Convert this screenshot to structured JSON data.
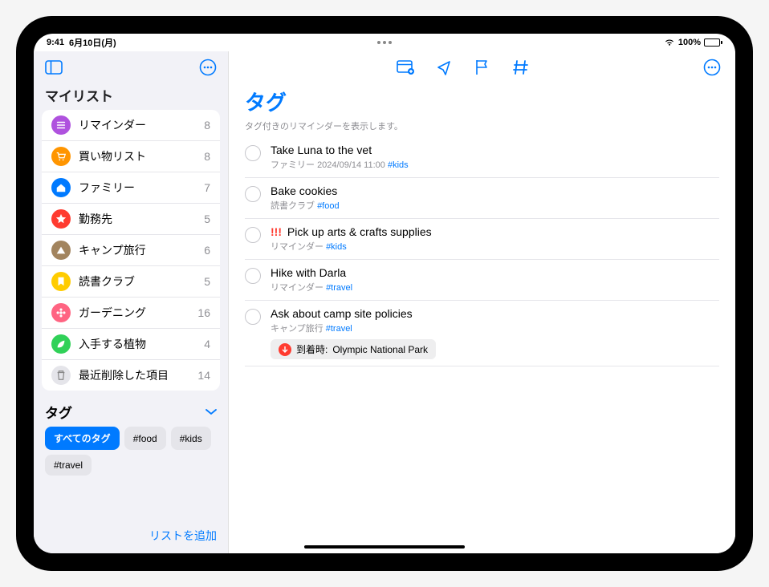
{
  "status": {
    "time": "9:41",
    "date": "6月10日(月)",
    "battery": "100%"
  },
  "sidebar": {
    "section_title": "マイリスト",
    "lists": [
      {
        "label": "リマインダー",
        "count": "8",
        "color": "#af52de",
        "icon": "list"
      },
      {
        "label": "買い物リスト",
        "count": "8",
        "color": "#ff9500",
        "icon": "cart"
      },
      {
        "label": "ファミリー",
        "count": "7",
        "color": "#007aff",
        "icon": "house"
      },
      {
        "label": "勤務先",
        "count": "5",
        "color": "#ff3b30",
        "icon": "star"
      },
      {
        "label": "キャンプ旅行",
        "count": "6",
        "color": "#a2845e",
        "icon": "tent"
      },
      {
        "label": "読書クラブ",
        "count": "5",
        "color": "#ffcc00",
        "icon": "bookmark"
      },
      {
        "label": "ガーデニング",
        "count": "16",
        "color": "#ff6482",
        "icon": "flower"
      },
      {
        "label": "入手する植物",
        "count": "4",
        "color": "#30d158",
        "icon": "leaf"
      },
      {
        "label": "最近削除した項目",
        "count": "14",
        "color": "#c7c7cc",
        "icon": "trash"
      }
    ],
    "tags_title": "タグ",
    "tags": {
      "all_label": "すべてのタグ",
      "items": [
        "#food",
        "#kids",
        "#travel"
      ]
    },
    "add_list": "リストを追加"
  },
  "main": {
    "title": "タグ",
    "subtitle": "タグ付きのリマインダーを表示します。",
    "reminders": [
      {
        "title": "Take Luna to the vet",
        "list": "ファミリー",
        "date": "2024/09/14 11:00",
        "tag": "#kids",
        "priority": ""
      },
      {
        "title": "Bake cookies",
        "list": "読書クラブ",
        "date": "",
        "tag": "#food",
        "priority": ""
      },
      {
        "title": "Pick up arts & crafts supplies",
        "list": "リマインダー",
        "date": "",
        "tag": "#kids",
        "priority": "!!!"
      },
      {
        "title": "Hike with Darla",
        "list": "リマインダー",
        "date": "",
        "tag": "#travel",
        "priority": ""
      },
      {
        "title": "Ask about camp site policies",
        "list": "キャンプ旅行",
        "date": "",
        "tag": "#travel",
        "priority": "",
        "location_label": "到着時:",
        "location_value": "Olympic National Park"
      }
    ]
  }
}
